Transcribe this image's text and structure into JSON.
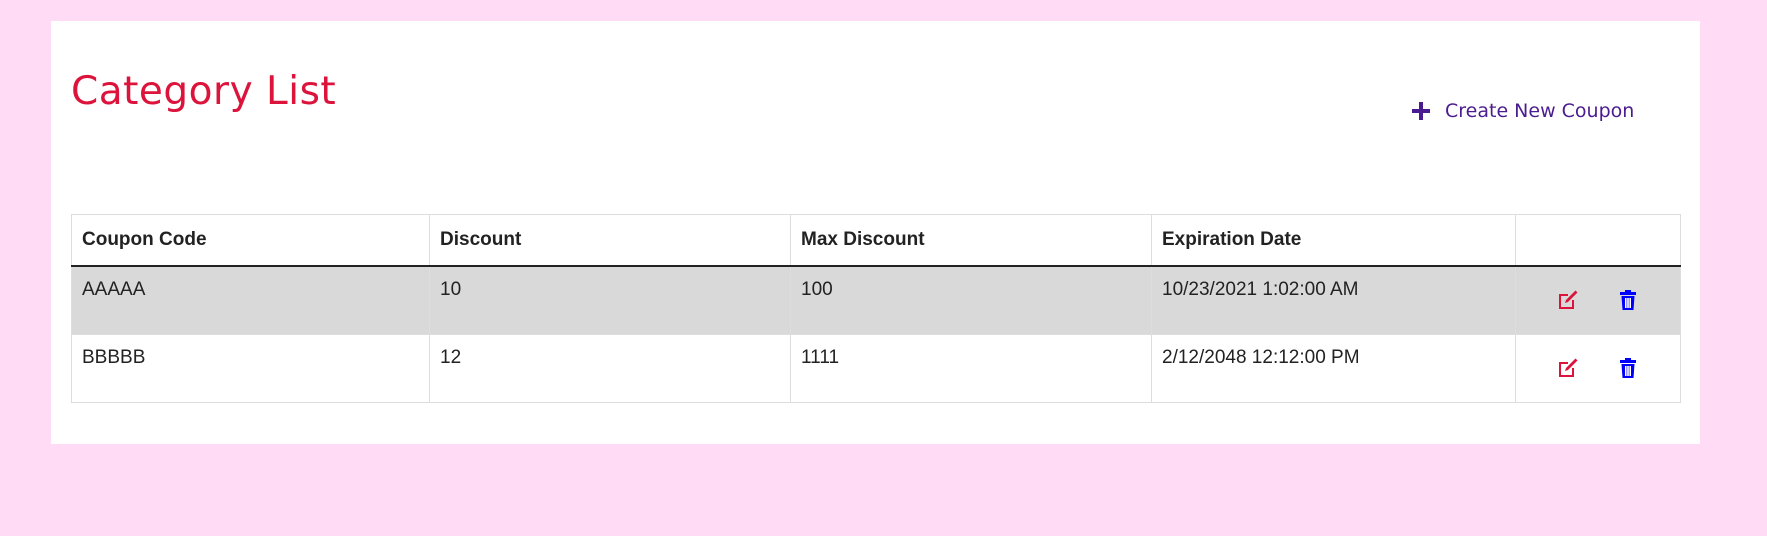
{
  "page": {
    "title": "Category List",
    "create_label": "Create New Coupon"
  },
  "table": {
    "headers": [
      "Coupon Code",
      "Discount",
      "Max Discount",
      "Expiration Date",
      ""
    ],
    "rows": [
      {
        "code": "AAAAA",
        "discount": "10",
        "max_discount": "100",
        "expiration": "10/23/2021 1:02:00 AM"
      },
      {
        "code": "BBBBB",
        "discount": "12",
        "max_discount": "1111",
        "expiration": "2/12/2048 12:12:00 PM"
      }
    ]
  },
  "icons": {
    "create": "plus-icon",
    "edit": "edit-icon",
    "delete": "trash-icon"
  },
  "colors": {
    "background": "#ffdbf5",
    "title": "#dc143c",
    "create_link": "#4b1c8f",
    "edit_icon": "#dc143c",
    "delete_icon": "#0000ff",
    "highlight_row": "#d9d9d9"
  }
}
